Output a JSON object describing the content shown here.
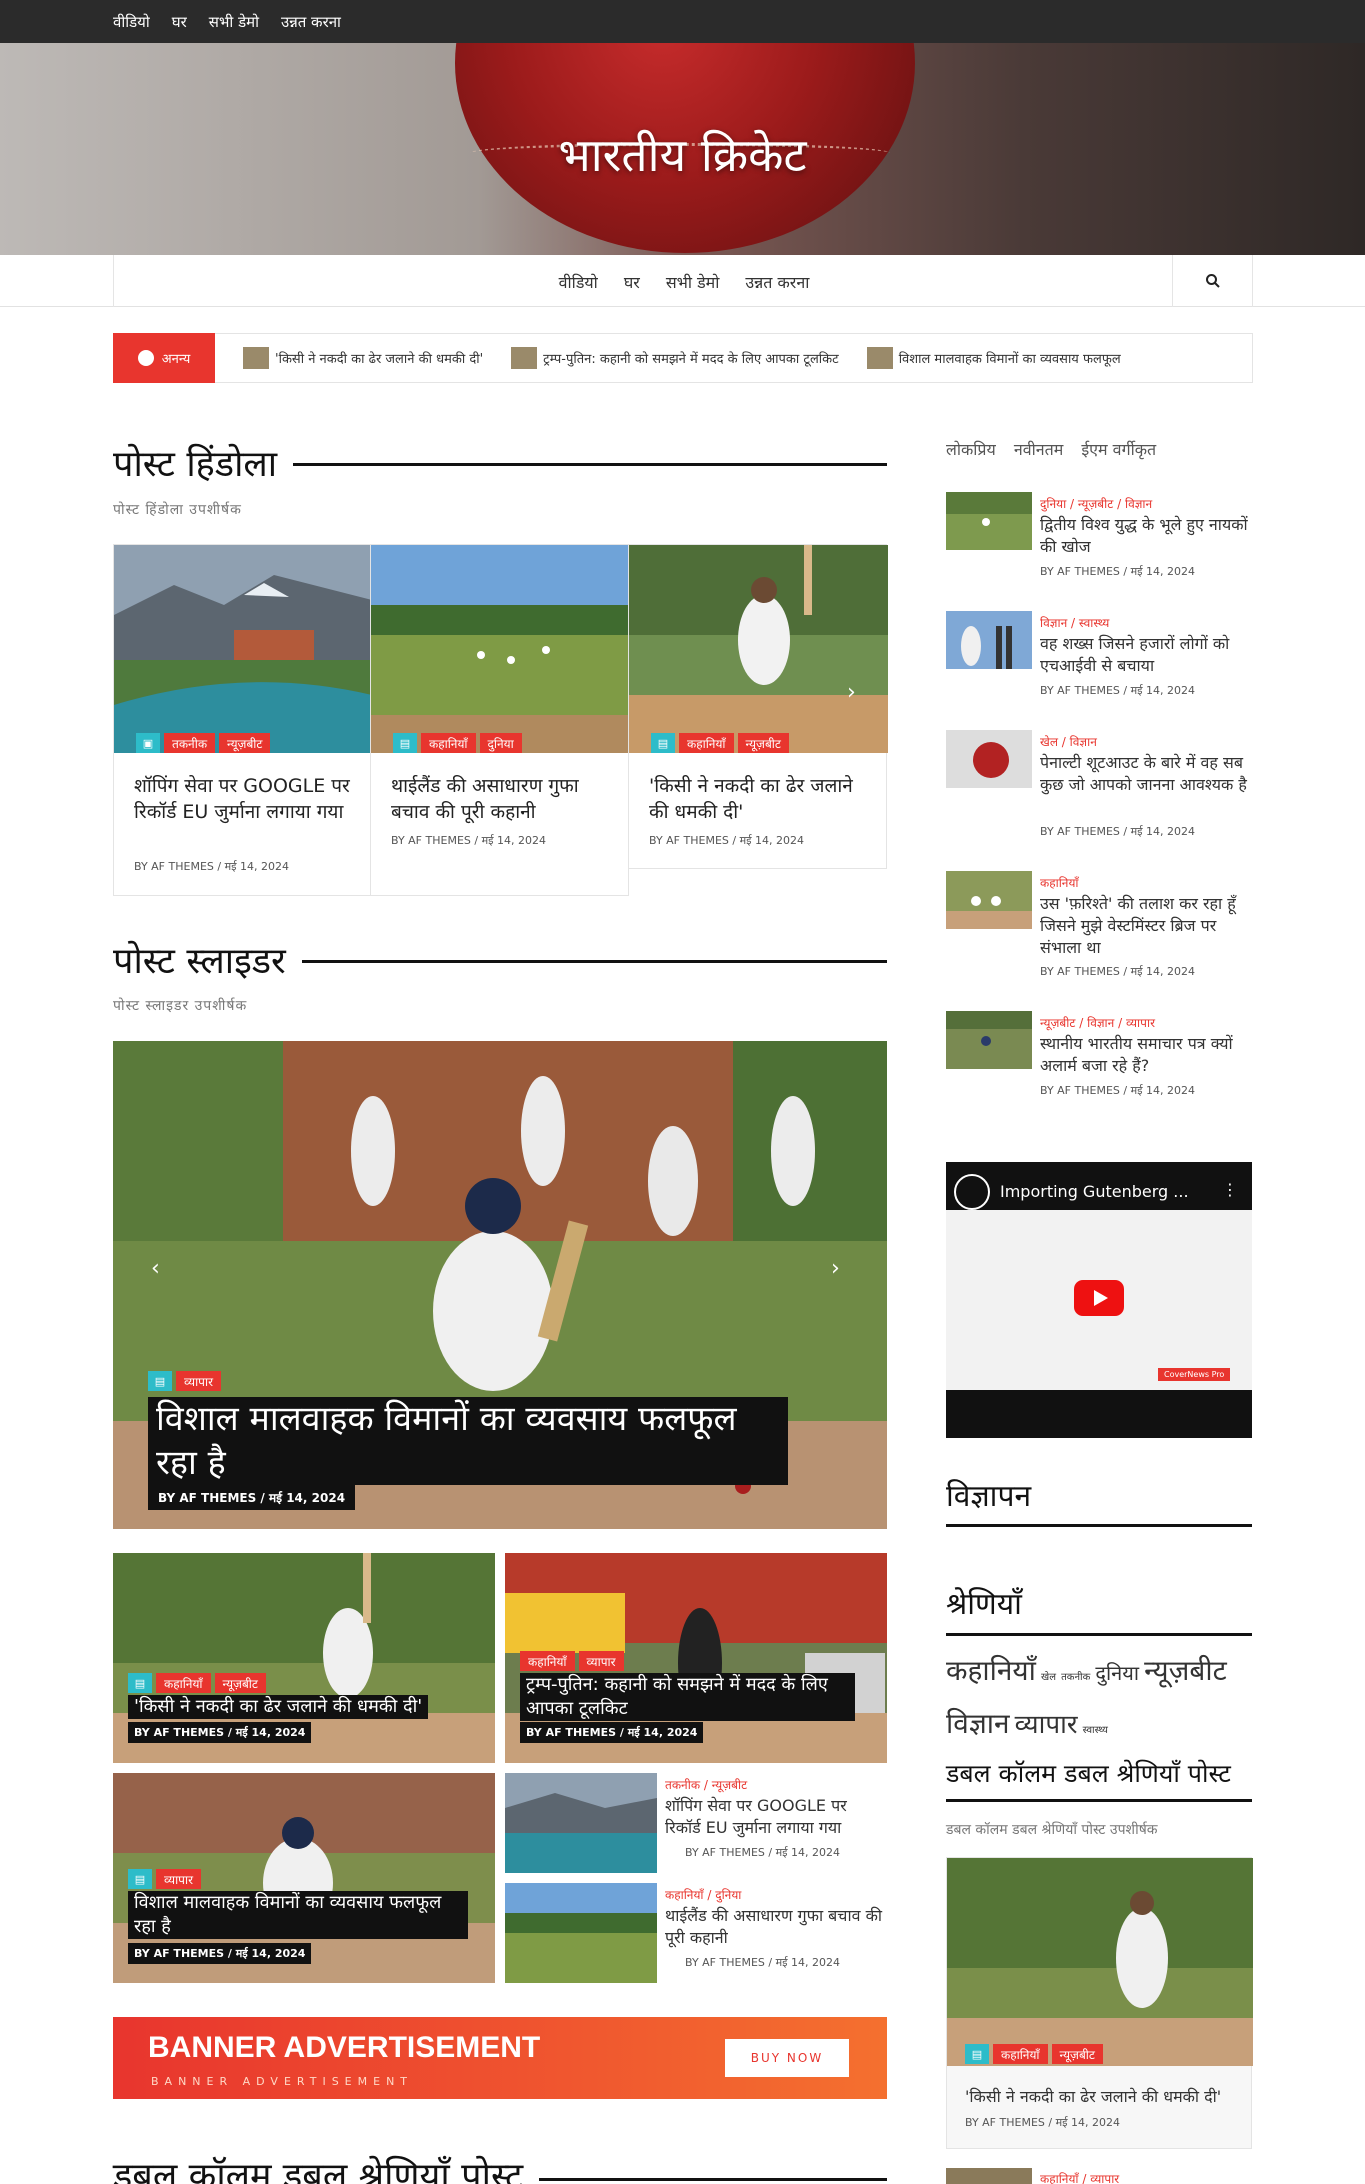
{
  "top_nav": [
    "वीडियो",
    "घर",
    "सभी डेमो",
    "उन्नत करना"
  ],
  "site_title": "भारतीय क्रिकेट",
  "main_nav": [
    "वीडियो",
    "घर",
    "सभी डेमो",
    "उन्नत करना"
  ],
  "ticker": {
    "label": "अनन्य",
    "items": [
      "'किसी ने नकदी का ढेर जलाने की धमकी दी'",
      "ट्रम्प-पुतिन: कहानी को समझने में मदद के लिए आपका टूलकिट",
      "विशाल मालवाहक विमानों का व्यवसाय फलफूल"
    ]
  },
  "carousel": {
    "title": "पोस्ट हिंडोला",
    "subtitle": "पोस्ट हिंडोला उपशीर्षक",
    "cards": [
      {
        "cats": [
          "तकनीक",
          "न्यूज़बीट"
        ],
        "title": "शॉपिंग सेवा पर GOOGLE पर रिकॉर्ड EU जुर्माना लगाया गया",
        "meta": "BY AF THEMES / मई 14, 2024"
      },
      {
        "cats": [
          "कहानियाँ",
          "दुनिया"
        ],
        "title": "थाईलैंड की असाधारण गुफा बचाव की पूरी कहानी",
        "meta": "BY AF THEMES / मई 14, 2024"
      },
      {
        "cats": [
          "कहानियाँ",
          "न्यूज़बीट"
        ],
        "title": "'किसी ने नकदी का ढेर जलाने की धमकी दी'",
        "meta": "BY AF THEMES / मई 14, 2024"
      }
    ]
  },
  "slider": {
    "title": "पोस्ट स्लाइडर",
    "subtitle": "पोस्ट स्लाइडर उपशीर्षक",
    "cat": "व्यापार",
    "post_title": "विशाल मालवाहक विमानों का व्यवसाय फलफूल रहा है",
    "meta": "BY AF THEMES / मई 14, 2024"
  },
  "grid": [
    {
      "cats": [
        "कहानियाँ",
        "न्यूज़बीट"
      ],
      "title": "'किसी ने नकदी का ढेर जलाने की धमकी दी'",
      "meta": "BY AF THEMES / मई 14, 2024"
    },
    {
      "cats": [
        "कहानियाँ",
        "व्यापार"
      ],
      "title": "ट्रम्प-पुतिन: कहानी को समझने में मदद के लिए आपका टूलकिट",
      "meta": "BY AF THEMES / मई 14, 2024"
    },
    {
      "cats": [
        "व्यापार"
      ],
      "title": "विशाल मालवाहक विमानों का व्यवसाय फलफूल रहा है",
      "meta": "BY AF THEMES / मई 14, 2024"
    }
  ],
  "grid_small": [
    {
      "cats": "तकनीक / न्यूज़बीट",
      "title": "शॉपिंग सेवा पर GOOGLE पर रिकॉर्ड EU जुर्माना लगाया गया",
      "meta": "BY AF THEMES / मई 14, 2024"
    },
    {
      "cats": "कहानियाँ / दुनिया",
      "title": "थाईलैंड की असाधारण गुफा बचाव की पूरी कहानी",
      "meta": "BY AF THEMES / मई 14, 2024"
    }
  ],
  "banner": {
    "big": "BANNER ADVERTISEMENT",
    "small": "BANNER ADVERTISEMENT",
    "button": "BUY NOW"
  },
  "bottom_section_title": "डबल कॉलम डबल श्रेणियाँ पोस्ट",
  "sidebar": {
    "tabs": [
      "लोकप्रिय",
      "नवीनतम",
      "ईएम वर्गीकृत"
    ],
    "posts": [
      {
        "cats": "दुनिया / न्यूज़बीट / विज्ञान",
        "title": "द्वितीय विश्व युद्ध के भूले हुए नायकों की खोज",
        "meta": "BY AF THEMES / मई 14, 2024"
      },
      {
        "cats": "विज्ञान / स्वास्थ्य",
        "title": "वह शख्स जिसने हजारों लोगों को एचआईवी से बचाया",
        "meta": "BY AF THEMES / मई 14, 2024"
      },
      {
        "cats": "खेल / विज्ञान",
        "title": "पेनाल्टी शूटआउट के बारे में वह सब कुछ जो आपको जानना आवश्यक है",
        "meta": "BY AF THEMES / मई 14, 2024"
      },
      {
        "cats": "कहानियाँ",
        "title": "उस 'फ़रिश्ते' की तलाश कर रहा हूँ जिसने मुझे वेस्टमिंस्टर ब्रिज पर संभाला था",
        "meta": "BY AF THEMES / मई 14, 2024"
      },
      {
        "cats": "न्यूज़बीट / विज्ञान / व्यापार",
        "title": "स्थानीय भारतीय समाचार पत्र क्यों अलार्म बजा रहे हैं?",
        "meta": "BY AF THEMES / मई 14, 2024"
      }
    ],
    "video_title": "Importing Gutenberg ...",
    "video_tag": "CoverNews Pro",
    "ad_title": "विज्ञापन",
    "categories_title": "श्रेणियाँ",
    "categories": [
      "कहानियाँ",
      "खेल",
      "तकनीक",
      "दुनिया",
      "न्यूज़बीट",
      "विज्ञान",
      "व्यापार",
      "स्वास्थ्य"
    ],
    "double_title": "डबल कॉलम डबल श्रेणियाँ पोस्ट",
    "double_sub": "डबल कॉलम डबल श्रेणियाँ पोस्ट उपशीर्षक",
    "double_card": {
      "cats": [
        "कहानियाँ",
        "न्यूज़बीट"
      ],
      "title": "'किसी ने नकदी का ढेर जलाने की धमकी दी'",
      "meta": "BY AF THEMES / मई 14, 2024"
    },
    "bottom_cats": "कहानियाँ / व्यापार"
  },
  "colors": {
    "accent": "#e8352e",
    "badge_icon": "#2dbcc9",
    "topbar": "#2b2b2b"
  }
}
